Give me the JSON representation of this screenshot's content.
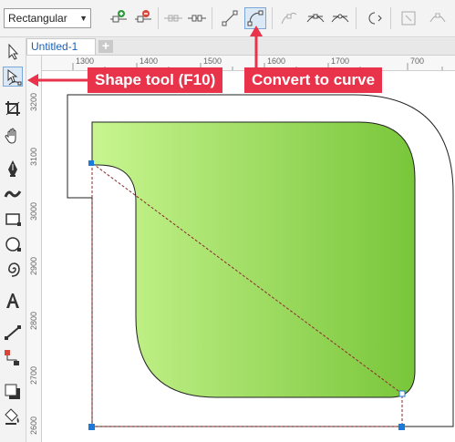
{
  "property_bar": {
    "shape_mode": "Rectangular"
  },
  "document": {
    "tab_label": "Untitled-1",
    "add_tab": "+"
  },
  "rulers": {
    "horizontal": [
      "1300",
      "1400",
      "1500",
      "1600",
      "1700",
      "700"
    ],
    "vertical": [
      "3200",
      "3100",
      "3000",
      "2900",
      "2800",
      "2700",
      "2600"
    ]
  },
  "callouts": {
    "shape_tool": "Shape tool (F10)",
    "convert_to_curve": "Convert to curve"
  },
  "colors": {
    "callout": "#e8334a",
    "gradient_start": "#c8f590",
    "gradient_end": "#79c63a",
    "outline": "#222222",
    "node": "#1b79d9",
    "selection_line": "#8a2a2a"
  }
}
